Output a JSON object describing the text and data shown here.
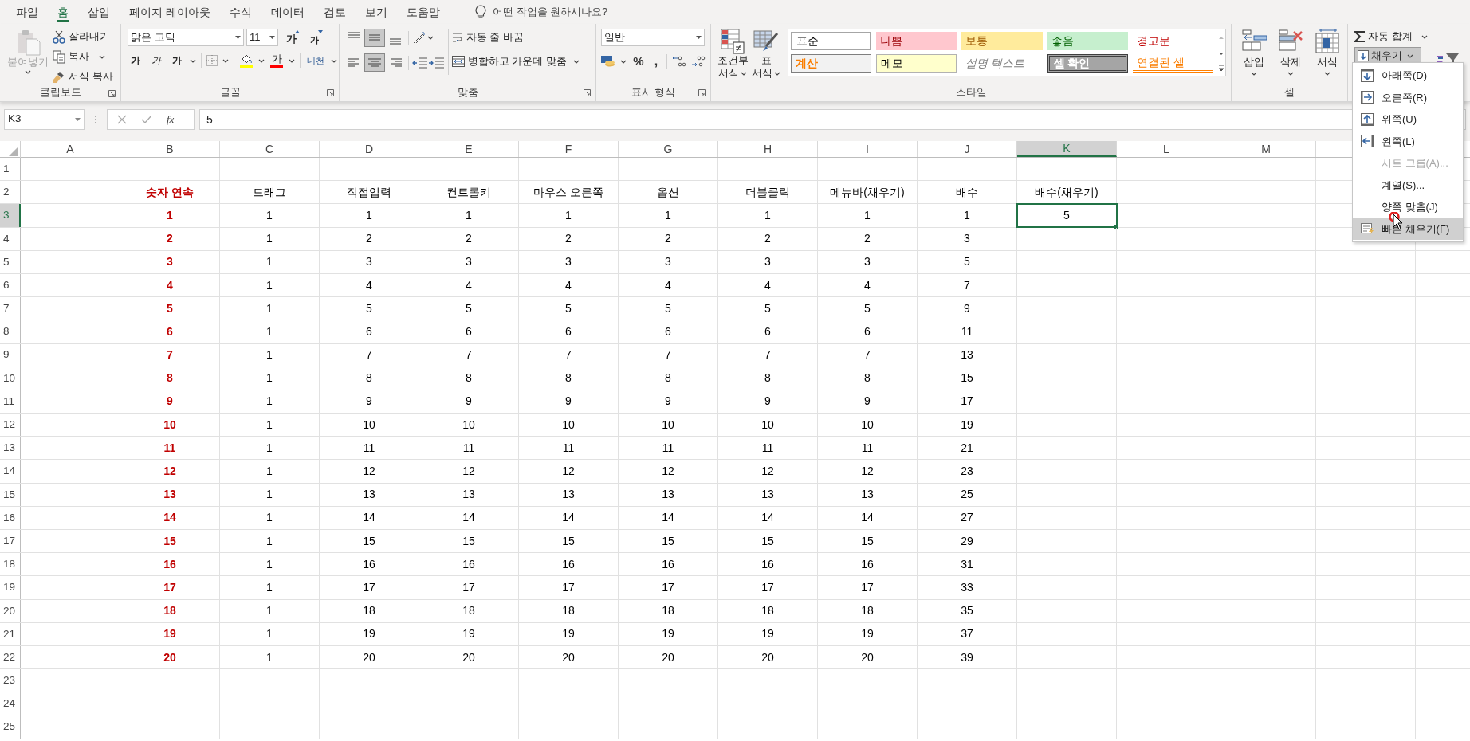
{
  "tabs": [
    {
      "label": "파일",
      "selected": false
    },
    {
      "label": "홈",
      "selected": true
    },
    {
      "label": "삽입",
      "selected": false
    },
    {
      "label": "페이지 레이아웃",
      "selected": false
    },
    {
      "label": "수식",
      "selected": false
    },
    {
      "label": "데이터",
      "selected": false
    },
    {
      "label": "검토",
      "selected": false
    },
    {
      "label": "보기",
      "selected": false
    },
    {
      "label": "도움말",
      "selected": false
    }
  ],
  "tell_me": {
    "placeholder": "어떤 작업을 원하시나요?"
  },
  "clipboard": {
    "label": "클립보드",
    "paste": {
      "label": "붙여넣기",
      "disabled": true
    },
    "cut": "잘라내기",
    "copy": "복사",
    "format_painter": "서식 복사"
  },
  "font": {
    "label": "글꼴",
    "font_name": "맑은 고딕",
    "font_size": "11",
    "grow": "가",
    "shrink": "가",
    "styles": [
      {
        "label": "가",
        "kind": "bold"
      },
      {
        "label": "가",
        "kind": "italic"
      },
      {
        "label": "가",
        "kind": "underline"
      }
    ],
    "font_color": "가",
    "phonetic": "내천"
  },
  "alignment": {
    "label": "맞춤",
    "wrap_text": "자동 줄 바꿈",
    "merge_center": "병합하고 가운데 맞춤"
  },
  "number": {
    "label": "표시 형식",
    "format": "일반",
    "percent": "%",
    "comma": ","
  },
  "styles": {
    "label": "스타일",
    "conditional": [
      "조건부",
      "서식"
    ],
    "format_table": [
      "표",
      "서식"
    ],
    "gallery": [
      {
        "label": "표준",
        "kind": "normal"
      },
      {
        "label": "나쁨",
        "kind": "bad"
      },
      {
        "label": "보통",
        "kind": "neutral"
      },
      {
        "label": "좋음",
        "kind": "good"
      },
      {
        "label": "경고문",
        "kind": "warning"
      },
      {
        "label": "계산",
        "kind": "calculation"
      },
      {
        "label": "메모",
        "kind": "note"
      },
      {
        "label": "설명 텍스트",
        "kind": "explanatory"
      },
      {
        "label": "셀 확인",
        "kind": "check"
      },
      {
        "label": "연결된 셀",
        "kind": "linked"
      }
    ]
  },
  "cells_group": {
    "label": "셀",
    "buttons": [
      {
        "label": "삽입",
        "kind": "insert"
      },
      {
        "label": "삭제",
        "kind": "delete"
      },
      {
        "label": "서식",
        "kind": "format"
      }
    ]
  },
  "editing": {
    "autosum": "자동 합계",
    "fill": {
      "label": "채우기",
      "expanded": true
    }
  },
  "fill_menu": [
    {
      "label": "아래쪽(D)",
      "kind": "down",
      "disabled": false,
      "selected": false
    },
    {
      "label": "오른쪽(R)",
      "kind": "right",
      "disabled": false,
      "selected": false
    },
    {
      "label": "위쪽(U)",
      "kind": "up",
      "disabled": false,
      "selected": false
    },
    {
      "label": "왼쪽(L)",
      "kind": "left",
      "disabled": false,
      "selected": false
    },
    {
      "label": "시트 그룹(A)...",
      "kind": "plain",
      "disabled": true,
      "selected": false
    },
    {
      "label": "계열(S)...",
      "kind": "plain",
      "disabled": false,
      "selected": false
    },
    {
      "label": "양쪽 맞춤(J)",
      "kind": "plain",
      "disabled": false,
      "selected": false
    },
    {
      "label": "빠른 채우기(F)",
      "kind": "flash",
      "disabled": false,
      "selected": true
    }
  ],
  "formula_bar": {
    "name_box": "K3",
    "function_label": "fx",
    "value": "5"
  },
  "sheet": {
    "columns": [
      {
        "label": "A",
        "selected": false,
        "emphasis": false
      },
      {
        "label": "B",
        "selected": false,
        "emphasis": true
      },
      {
        "label": "C",
        "selected": false,
        "emphasis": false
      },
      {
        "label": "D",
        "selected": false,
        "emphasis": false
      },
      {
        "label": "E",
        "selected": false,
        "emphasis": false
      },
      {
        "label": "F",
        "selected": false,
        "emphasis": false
      },
      {
        "label": "G",
        "selected": false,
        "emphasis": false
      },
      {
        "label": "H",
        "selected": false,
        "emphasis": false
      },
      {
        "label": "I",
        "selected": false,
        "emphasis": false
      },
      {
        "label": "J",
        "selected": false,
        "emphasis": false
      },
      {
        "label": "K",
        "selected": true,
        "emphasis": false
      },
      {
        "label": "L",
        "selected": false,
        "emphasis": false
      },
      {
        "label": "M",
        "selected": false,
        "emphasis": false
      }
    ],
    "rows": [
      {
        "label": "1",
        "selected": false
      },
      {
        "label": "2",
        "selected": false,
        "cells": [
          "숫자 연속",
          "드래그",
          "직접입력",
          "컨트롤키",
          "마우스 오른쪽",
          "옵션",
          "더블클릭",
          "메뉴바(채우기)",
          "배수",
          "배수(채우기)"
        ]
      },
      {
        "label": "3",
        "selected": true,
        "cells": [
          "1",
          "1",
          "1",
          "1",
          "1",
          "1",
          "1",
          "1",
          "1",
          "5"
        ]
      },
      {
        "label": "4",
        "selected": false,
        "cells": [
          "2",
          "1",
          "2",
          "2",
          "2",
          "2",
          "2",
          "2",
          "3"
        ]
      },
      {
        "label": "5",
        "selected": false,
        "cells": [
          "3",
          "1",
          "3",
          "3",
          "3",
          "3",
          "3",
          "3",
          "5"
        ]
      },
      {
        "label": "6",
        "selected": false,
        "cells": [
          "4",
          "1",
          "4",
          "4",
          "4",
          "4",
          "4",
          "4",
          "7"
        ]
      },
      {
        "label": "7",
        "selected": false,
        "cells": [
          "5",
          "1",
          "5",
          "5",
          "5",
          "5",
          "5",
          "5",
          "9"
        ]
      },
      {
        "label": "8",
        "selected": false,
        "cells": [
          "6",
          "1",
          "6",
          "6",
          "6",
          "6",
          "6",
          "6",
          "11"
        ]
      },
      {
        "label": "9",
        "selected": false,
        "cells": [
          "7",
          "1",
          "7",
          "7",
          "7",
          "7",
          "7",
          "7",
          "13"
        ]
      },
      {
        "label": "10",
        "selected": false,
        "cells": [
          "8",
          "1",
          "8",
          "8",
          "8",
          "8",
          "8",
          "8",
          "15"
        ]
      },
      {
        "label": "11",
        "selected": false,
        "cells": [
          "9",
          "1",
          "9",
          "9",
          "9",
          "9",
          "9",
          "9",
          "17"
        ]
      },
      {
        "label": "12",
        "selected": false,
        "cells": [
          "10",
          "1",
          "10",
          "10",
          "10",
          "10",
          "10",
          "10",
          "19"
        ]
      },
      {
        "label": "13",
        "selected": false,
        "cells": [
          "11",
          "1",
          "11",
          "11",
          "11",
          "11",
          "11",
          "11",
          "21"
        ]
      },
      {
        "label": "14",
        "selected": false,
        "cells": [
          "12",
          "1",
          "12",
          "12",
          "12",
          "12",
          "12",
          "12",
          "23"
        ]
      },
      {
        "label": "15",
        "selected": false,
        "cells": [
          "13",
          "1",
          "13",
          "13",
          "13",
          "13",
          "13",
          "13",
          "25"
        ]
      },
      {
        "label": "16",
        "selected": false,
        "cells": [
          "14",
          "1",
          "14",
          "14",
          "14",
          "14",
          "14",
          "14",
          "27"
        ]
      },
      {
        "label": "17",
        "selected": false,
        "cells": [
          "15",
          "1",
          "15",
          "15",
          "15",
          "15",
          "15",
          "15",
          "29"
        ]
      },
      {
        "label": "18",
        "selected": false,
        "cells": [
          "16",
          "1",
          "16",
          "16",
          "16",
          "16",
          "16",
          "16",
          "31"
        ]
      },
      {
        "label": "19",
        "selected": false,
        "cells": [
          "17",
          "1",
          "17",
          "17",
          "17",
          "17",
          "17",
          "17",
          "33"
        ]
      },
      {
        "label": "20",
        "selected": false,
        "cells": [
          "18",
          "1",
          "18",
          "18",
          "18",
          "18",
          "18",
          "18",
          "35"
        ]
      },
      {
        "label": "21",
        "selected": false,
        "cells": [
          "19",
          "1",
          "19",
          "19",
          "19",
          "19",
          "19",
          "19",
          "37"
        ]
      },
      {
        "label": "22",
        "selected": false,
        "cells": [
          "20",
          "1",
          "20",
          "20",
          "20",
          "20",
          "20",
          "20",
          "39"
        ]
      },
      {
        "label": "23",
        "selected": false
      },
      {
        "label": "24",
        "selected": false
      },
      {
        "label": "25",
        "selected": false
      }
    ]
  }
}
